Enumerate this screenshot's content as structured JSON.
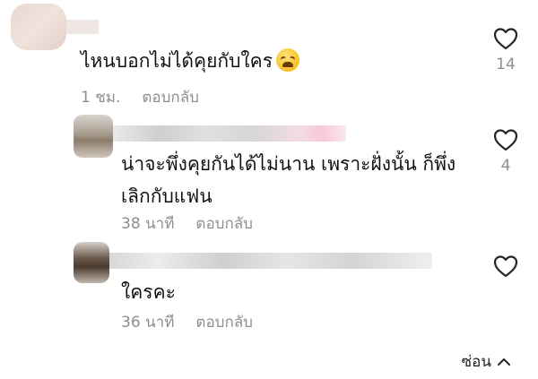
{
  "comments": [
    {
      "text": "ไหนบอกไม่ได้คุยกับใคร",
      "time": "1 ชม.",
      "reply_label": "ตอบกลับ",
      "likes": "14",
      "emoji": "tired-face-emoji"
    },
    {
      "text_line1": "น่าจะพึ่งคุยกันได้ไม่นาน เพราะฝั่งนั้น ก็พึ่ง",
      "text_line2": "เลิกกับแฟน",
      "time": "38 นาที",
      "reply_label": "ตอบกลับ",
      "likes": "4"
    },
    {
      "text": "ใครคะ",
      "time": "36 นาที",
      "reply_label": "ตอบกลับ",
      "likes": ""
    }
  ],
  "footer": {
    "hide_label": "ซ่อน"
  },
  "colors": {
    "text": "#111111",
    "meta": "#8e8e8e",
    "icon": "#262626"
  }
}
